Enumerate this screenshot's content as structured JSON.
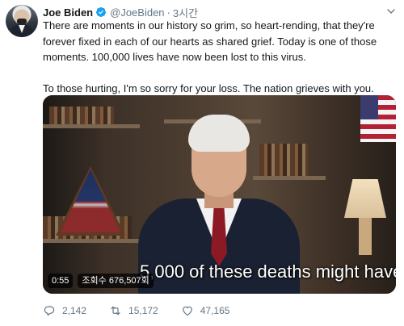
{
  "author": {
    "name": "Joe Biden",
    "handle": "@JoeBiden",
    "separator": "·",
    "time": "3시간"
  },
  "tweet": {
    "paragraph1": "There are moments in our history so grim, so heart-rending, that they're forever fixed in each of our hearts as shared grief. Today is one of those moments. 100,000 lives have now been lost to this virus.",
    "paragraph2": "To those hurting, I'm so sorry for your loss. The nation grieves with you."
  },
  "video": {
    "subtitle": "5,000 of these deaths might have",
    "duration": "0:55",
    "views": "조회수 676,507회"
  },
  "actions": {
    "replies": "2,142",
    "retweets": "15,172",
    "likes": "47,165"
  },
  "colors": {
    "verified": "#1da1f2",
    "muted": "#657786",
    "text": "#14171a"
  },
  "icons": [
    "verified-badge-icon",
    "more-chevron-icon",
    "reply-icon",
    "retweet-icon",
    "like-icon"
  ]
}
